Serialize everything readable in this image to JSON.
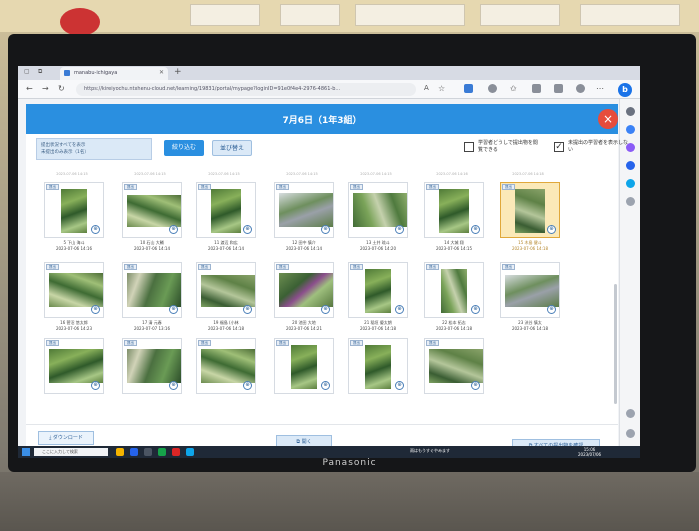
{
  "browser": {
    "tab_title": "manabu-ichigaya",
    "new_tab": "+",
    "url": "https://kireiyochu.ntxhenu-cloud.net/learning/19831/portal/mypage?loginID=91e0f4e4-2976-4861-b...",
    "read_aloud": "A",
    "copilot": "b"
  },
  "app": {
    "title": "7月6日（1年3組）",
    "close_symbol": "×",
    "filter_line1": "提出状況すべてを表示",
    "filter_line2": "未提出のみ表示（1名）",
    "narrow_button": "絞り込む",
    "sort_button": "並び替え",
    "checkbox1_label": "学習者どうしで提出物を閲覧できる",
    "checkbox1_checked": false,
    "checkbox2_label": "未提出の学習者を表示しない",
    "checkbox2_checked": true,
    "check_mark": "✓"
  },
  "thumb_badge": "提出",
  "zoom_symbol": "⊕",
  "row_heads": [
    "2023-07-06 14:15",
    "2023-07-06 14:15",
    "2023-07-06 14:15",
    "2023-07-06 14:15",
    "2023-07-06 14:15",
    "2023-07-06 14:16",
    "2023-07-06 14:18"
  ],
  "cards": [
    {
      "name": "5 下山 海斗",
      "date": "2023-07-06 14:16"
    },
    {
      "name": "10 石山 大輔",
      "date": "2023-07-06 14:14"
    },
    {
      "name": "11 渡辺 和広",
      "date": "2023-07-06 14:14"
    },
    {
      "name": "12 田中 慎介",
      "date": "2023-07-06 14:14"
    },
    {
      "name": "13 土井 琉斗",
      "date": "2023-07-06 14:20"
    },
    {
      "name": "14 大城 翔",
      "date": "2023-07-06 14:15"
    },
    {
      "name": "15 木島 健斗",
      "date": "2023-07-06 14:18"
    },
    {
      "name": "16 菅沼 悠太郎",
      "date": "2023-07-06 14:23"
    },
    {
      "name": "17 清 元春",
      "date": "2023-07-07 13:16"
    },
    {
      "name": "19 福島 (小林",
      "date": "2023-07-06 14:18"
    },
    {
      "name": "20 池田 大地",
      "date": "2023-07-06 14:21"
    },
    {
      "name": "21 稲垣 優太朗",
      "date": "2023-07-06 14:18"
    },
    {
      "name": "22 松本 拓志",
      "date": "2023-07-06 14:18"
    },
    {
      "name": "23 渋谷 慎太",
      "date": "2023-07-06 14:18"
    },
    {
      "name": "",
      "date": ""
    },
    {
      "name": "",
      "date": ""
    },
    {
      "name": "",
      "date": ""
    },
    {
      "name": "",
      "date": ""
    },
    {
      "name": "",
      "date": ""
    },
    {
      "name": "",
      "date": ""
    }
  ],
  "bottom": {
    "download": "ダウンロード",
    "open": "開く",
    "view_all": "すべての提出物を確認"
  },
  "taskbar": {
    "search_placeholder": "ここに入力して検索",
    "weather": "雨はもうすぐやみます",
    "time": "15:06",
    "date": "2023/07/06"
  },
  "tv_brand": "Panasonic"
}
